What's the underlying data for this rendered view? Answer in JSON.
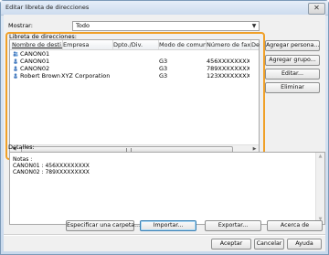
{
  "window": {
    "title": "Editar libreta de direcciones",
    "close_symbol": "✕"
  },
  "filter": {
    "label": "Mostrar:",
    "value": "Todo"
  },
  "address_book": {
    "label": "Libreta de direcciones:",
    "columns": [
      "Nombre de desti...",
      "Empresa",
      "Dpto./Div.",
      "Modo de comuni...",
      "Número de fax/...",
      "Dest"
    ],
    "rows": [
      {
        "icon": "group-icon",
        "name": "CANON01",
        "company": "",
        "dept": "",
        "mode": "",
        "number": ""
      },
      {
        "icon": "person-icon",
        "name": "CANON01",
        "company": "",
        "dept": "",
        "mode": "G3",
        "number": "456XXXXXXXXX"
      },
      {
        "icon": "person-icon",
        "name": "CANON02",
        "company": "",
        "dept": "",
        "mode": "G3",
        "number": "789XXXXXXXXX"
      },
      {
        "icon": "person-icon",
        "name": "Robert Brown",
        "company": "XYZ Corporation",
        "dept": "",
        "mode": "G3",
        "number": "123XXXXXXXXX"
      }
    ]
  },
  "side_buttons": {
    "add_person": "Agregar persona...",
    "add_group": "Agregar grupo...",
    "edit": "Editar...",
    "delete": "Eliminar"
  },
  "details": {
    "label": "Detalles:",
    "lines": [
      "Notas     :",
      "CANON01 : 456XXXXXXXXX",
      "CANON02 : 789XXXXXXXXX"
    ]
  },
  "actions": {
    "specify_folder": "Especificar una carpeta...",
    "import": "Importar...",
    "export": "Exportar...",
    "about": "Acerca de"
  },
  "footer": {
    "accept": "Aceptar",
    "cancel": "Cancelar",
    "help": "Ayuda"
  },
  "colors": {
    "highlight": "#f0a028",
    "window_frame": "#7c9ab8"
  }
}
